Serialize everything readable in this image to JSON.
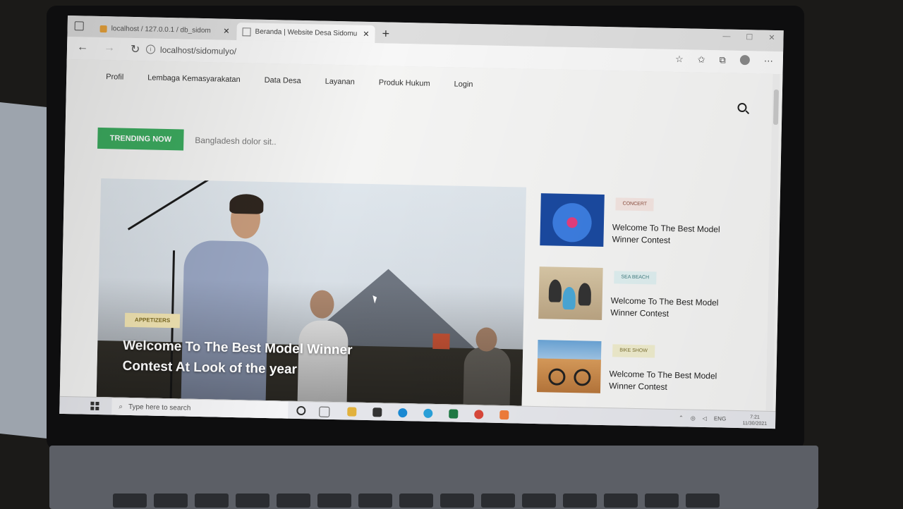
{
  "browser": {
    "tabs": [
      {
        "title": "localhost / 127.0.0.1 / db_sidom",
        "active": false
      },
      {
        "title": "Beranda | Website Desa Sidomu",
        "active": true
      }
    ],
    "url": "localhost/sidomulyo/"
  },
  "nav": {
    "items": [
      "Profil",
      "Lembaga Kemasyarakatan",
      "Data Desa",
      "Layanan",
      "Produk Hukum",
      "Login"
    ]
  },
  "trending": {
    "label": "TRENDING NOW",
    "text": "Bangladesh dolor sit.."
  },
  "hero": {
    "tag": "APPETIZERS",
    "title": "Welcome To The Best Model Winner Contest At Look of the year"
  },
  "side_posts": [
    {
      "tag": "CONCERT",
      "tag_color": "#f3e4e0",
      "title": "Welcome To The Best Model Winner Contest"
    },
    {
      "tag": "SEA BEACH",
      "tag_color": "#dfeff0",
      "title": "Welcome To The Best Model Winner Contest"
    },
    {
      "tag": "BIKE SHOW",
      "tag_color": "#efeccd",
      "title": "Welcome To The Best Model Winner Contest"
    }
  ],
  "taskbar": {
    "search_placeholder": "Type here to search",
    "lang": "ENG",
    "time": "7:21",
    "date": "11/30/2021"
  },
  "colors": {
    "trending_green": "#3cab5f",
    "hero_tag": "#f1e4b2"
  }
}
